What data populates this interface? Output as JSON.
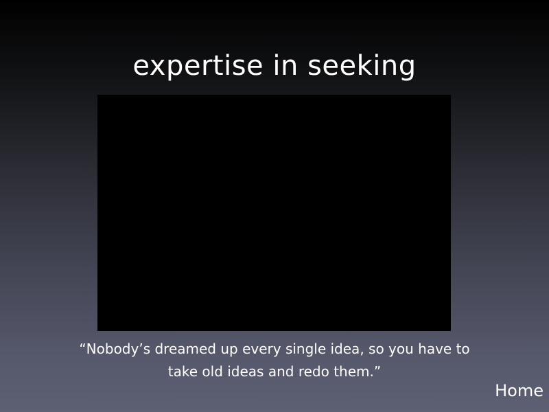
{
  "slide": {
    "title": "expertise in seeking",
    "quote_line_1": "“Nobody’s dreamed up every single idea, so you have to",
    "quote_line_2": "take old ideas and redo them.”",
    "home_label": "Home"
  },
  "colors": {
    "background_top": "#000000",
    "background_bottom": "#5d5f73",
    "media_frame": "#000000",
    "text": "#ffffff"
  }
}
